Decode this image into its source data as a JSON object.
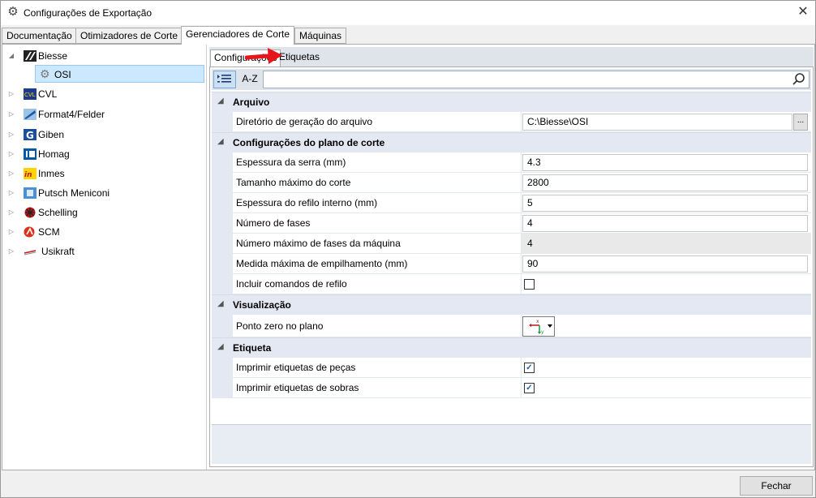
{
  "window": {
    "title": "Configurações de Exportação",
    "close_glyph": "✕"
  },
  "tabs": [
    {
      "label": "Documentação"
    },
    {
      "label": "Otimizadores de Corte"
    },
    {
      "label": "Gerenciadores de Corte",
      "active": true
    },
    {
      "label": "Máquinas"
    }
  ],
  "tree": {
    "items": [
      {
        "label": "Biesse",
        "icon": "biesse-logo",
        "expanded": true
      },
      {
        "label": "OSI",
        "icon": "gear-icon",
        "selected": true,
        "child": true
      },
      {
        "label": "CVL",
        "icon": "cvl-logo"
      },
      {
        "label": "Format4/Felder",
        "icon": "format4-logo"
      },
      {
        "label": "Giben",
        "icon": "giben-logo"
      },
      {
        "label": "Homag",
        "icon": "homag-logo"
      },
      {
        "label": "Inmes",
        "icon": "inmes-logo"
      },
      {
        "label": "Putsch Meniconi",
        "icon": "putsch-logo"
      },
      {
        "label": "Schelling",
        "icon": "schelling-logo"
      },
      {
        "label": "SCM",
        "icon": "scm-logo"
      },
      {
        "label": "Usikraft",
        "icon": "usikraft-logo"
      }
    ]
  },
  "subtabs": [
    {
      "label": "Configurações",
      "active": true
    },
    {
      "label": "Etiquetas"
    }
  ],
  "toolbar": {
    "categorized_icon": "categorized-list-icon",
    "alphabetical_label": "A-Z",
    "search_value": "",
    "search_icon": "search-icon"
  },
  "grid": {
    "categories": [
      {
        "label": "Arquivo",
        "rows": [
          {
            "name": "Diretório de geração do arquivo",
            "value": "C:\\Biesse\\OSI",
            "type": "path",
            "browse_label": "..."
          }
        ]
      },
      {
        "label": "Configurações do plano de corte",
        "rows": [
          {
            "name": "Espessura da serra (mm)",
            "value": "4.3",
            "type": "text"
          },
          {
            "name": "Tamanho máximo do corte",
            "value": "2800",
            "type": "text"
          },
          {
            "name": "Espessura do refilo interno (mm)",
            "value": "5",
            "type": "text"
          },
          {
            "name": "Número de fases",
            "value": "4",
            "type": "text"
          },
          {
            "name": "Número máximo de fases da máquina",
            "value": "4",
            "type": "readonly"
          },
          {
            "name": "Medida máxima de empilhamento (mm)",
            "value": "90",
            "type": "text"
          },
          {
            "name": "Incluir comandos de refilo",
            "checked": false,
            "type": "checkbox"
          }
        ]
      },
      {
        "label": "Visualização",
        "rows": [
          {
            "name": "Ponto zero no plano",
            "type": "origin",
            "icon": "axis-origin-icon"
          }
        ]
      },
      {
        "label": "Etiqueta",
        "rows": [
          {
            "name": "Imprimir etiquetas de peças",
            "checked": true,
            "type": "checkbox"
          },
          {
            "name": "Imprimir etiquetas de sobras",
            "checked": true,
            "type": "checkbox"
          }
        ]
      }
    ]
  },
  "footer": {
    "close_label": "Fechar"
  },
  "colors": {
    "arrow": "#e8161b",
    "selection": "#cce8ff",
    "category_bg": "#e3e8f2"
  }
}
